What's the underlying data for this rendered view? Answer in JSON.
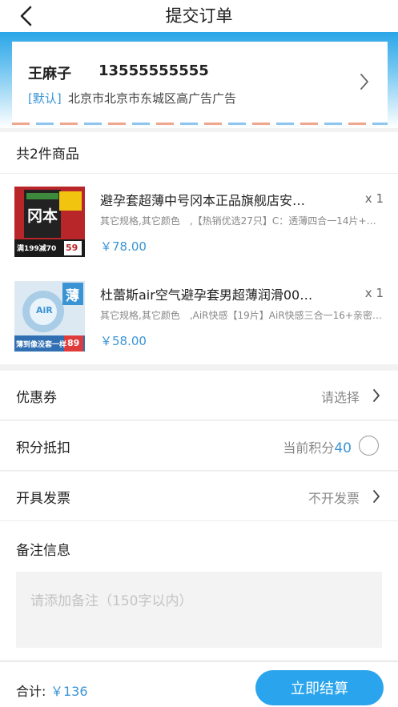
{
  "header": {
    "title": "提交订单"
  },
  "address": {
    "name": "王麻子",
    "phone": "13555555555",
    "tag": "[默认]",
    "detail": "北京市北京市东城区高广告广告"
  },
  "goods": {
    "count_label": "共2件商品",
    "items": [
      {
        "name": "避孕套超薄中号冈本正品旗舰店安…",
        "qty": "x 1",
        "spec": "其它规格,其它颜色　,【热销优选27只】C：透薄四合一14片+…",
        "price": "￥78.00",
        "thumb_text": "冈本",
        "thumb_promo": "满199减70",
        "thumb_price": "59"
      },
      {
        "name": "杜蕾斯air空气避孕套男超薄润滑00…",
        "qty": "x 1",
        "spec": "其它规格,其它颜色　,AiR快感【19片】AiR快感三合一16+亲密…",
        "price": "￥58.00",
        "thumb_text": "薄",
        "thumb_brand": "AiR",
        "thumb_promo": "薄到像没套一样",
        "thumb_price": "89"
      }
    ]
  },
  "coupon": {
    "label": "优惠券",
    "value": "请选择"
  },
  "points": {
    "label": "积分抵扣",
    "value_prefix": "当前积分",
    "value": "40"
  },
  "invoice": {
    "label": "开具发票",
    "value": "不开发票"
  },
  "remark": {
    "label": "备注信息",
    "placeholder": "请添加备注（150字以内）"
  },
  "footer": {
    "total_label": "合计:",
    "total_value": "￥136",
    "pay_label": "立即结算"
  },
  "colors": {
    "accent": "#2aa4ec",
    "price": "#3b95d6"
  }
}
